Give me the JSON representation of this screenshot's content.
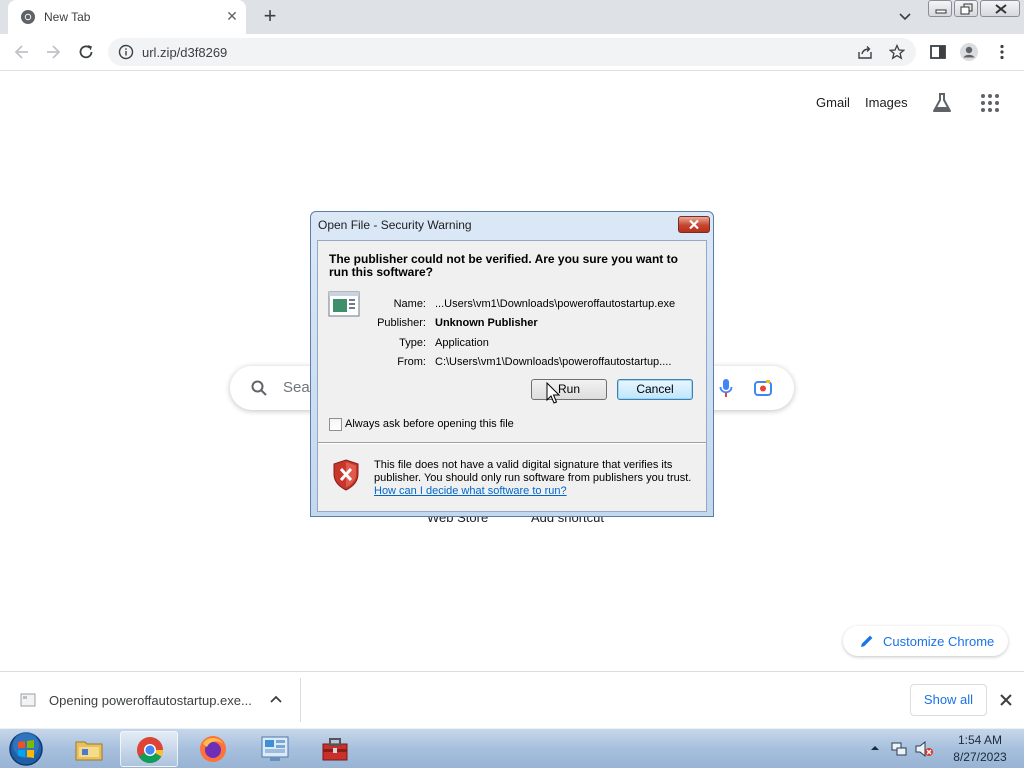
{
  "browser": {
    "tab": {
      "title": "New Tab"
    },
    "omnibox": {
      "url": "url.zip/d3f8269"
    }
  },
  "ntp": {
    "links": {
      "gmail": "Gmail",
      "images": "Images"
    },
    "search_placeholder": "Sea",
    "shortcuts": [
      "Web Store",
      "Add shortcut"
    ],
    "customize_label": "Customize Chrome"
  },
  "dialog": {
    "title": "Open File - Security Warning",
    "heading": "The publisher could not be verified.  Are you sure you want to run this software?",
    "fields": [
      {
        "label": "Name:",
        "value": "...Users\\vm1\\Downloads\\poweroffautostartup.exe",
        "bold": false
      },
      {
        "label": "Publisher:",
        "value": "Unknown Publisher",
        "bold": true
      },
      {
        "label": "Type:",
        "value": "Application",
        "bold": false
      },
      {
        "label": "From:",
        "value": "C:\\Users\\vm1\\Downloads\\poweroffautostartup....",
        "bold": false
      }
    ],
    "run_label": "Run",
    "cancel_label": "Cancel",
    "checkbox": {
      "label": "Always ask before opening this file",
      "checked": false
    },
    "warning_text": "This file does not have a valid digital signature that verifies its publisher.  You should only run software from publishers you trust.",
    "help_link": "How can I decide what software to run?"
  },
  "download_bar": {
    "item_label": "Opening poweroffautostartup.exe...",
    "show_all_label": "Show all"
  },
  "taskbar": {
    "items": [
      "windows-explorer",
      "chrome",
      "firefox",
      "control-panel",
      "toolbox"
    ],
    "active_item": "chrome",
    "clock": {
      "time": "1:54 AM",
      "date": "8/27/2023"
    }
  },
  "colors": {
    "accent_blue": "#1a73e8",
    "tabstrip": "#dee1e6",
    "dialog_frame": "#c4d8ee",
    "link_blue": "#0066cc"
  }
}
